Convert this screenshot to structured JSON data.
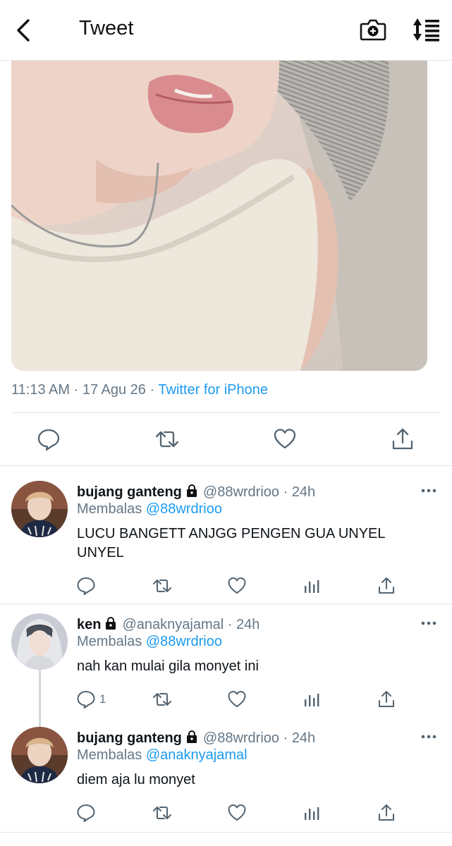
{
  "header": {
    "title": "Tweet",
    "icons": [
      "back-chevron-icon",
      "camera-plus-icon",
      "sort-icon"
    ]
  },
  "tweet": {
    "time": "11:13 AM",
    "sep1": "·",
    "date": "17 Agu 26",
    "sep2": "·",
    "source": "Twitter for iPhone",
    "actions": [
      "reply-icon",
      "retweet-icon",
      "like-icon",
      "share-icon"
    ]
  },
  "replies": [
    {
      "name": "bujang ganteng",
      "handle": "@88wrdrioo",
      "sep": "·",
      "time": "24h",
      "replying_label": "Membalas",
      "replying_to": "@88wrdrioo",
      "text": "LUCU BANGETT ANJGG PENGEN GUA UNYEL UNYEL",
      "reply_count": ""
    },
    {
      "name": "ken",
      "handle": "@anaknyajamal",
      "sep": "·",
      "time": "24h",
      "replying_label": "Membalas",
      "replying_to": "@88wrdrioo",
      "text": "nah kan mulai gila monyet ini",
      "reply_count": "1"
    },
    {
      "name": "bujang ganteng",
      "handle": "@88wrdrioo",
      "sep": "·",
      "time": "24h",
      "replying_label": "Membalas",
      "replying_to": "@anaknyajamal",
      "text": "diem aja lu monyet",
      "reply_count": ""
    }
  ],
  "colors": {
    "accent": "#1d9bf0",
    "secondary_text": "#657786",
    "divider": "#e6e6e6"
  }
}
